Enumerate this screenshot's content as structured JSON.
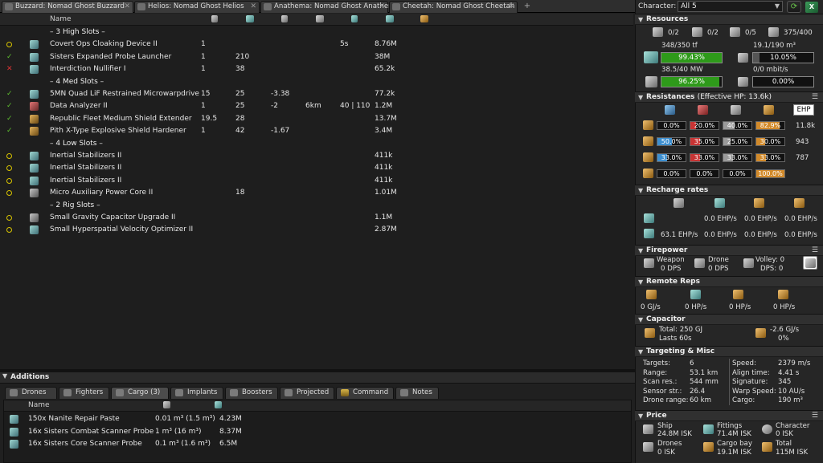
{
  "tabs": [
    {
      "label": "Buzzard: Nomad Ghost Buzzard"
    },
    {
      "label": "Helios: Nomad Ghost Helios"
    },
    {
      "label": "Anathema: Nomad Ghost Anathema"
    },
    {
      "label": "Cheetah: Nomad Ghost Cheetah"
    }
  ],
  "fitting": {
    "name_header": "Name",
    "rows": [
      {
        "kind": "rack",
        "name": "– 3 High Slots –"
      },
      {
        "kind": "mod",
        "state": "o",
        "icon": "cloak-icon",
        "name": "Covert Ops Cloaking Device II",
        "c1": "1",
        "c2": "",
        "c3": "",
        "c4": "",
        "c5": "5s",
        "c6": "8.76M"
      },
      {
        "kind": "mod",
        "state": "c",
        "icon": "probe-launcher-icon",
        "name": "Sisters Expanded Probe Launcher",
        "c1": "1",
        "c2": "210",
        "c3": "",
        "c4": "",
        "c5": "",
        "c6": "38M"
      },
      {
        "kind": "mod",
        "state": "x",
        "icon": "nullifier-icon",
        "name": "Interdiction Nullifier I",
        "c1": "1",
        "c2": "38",
        "c3": "",
        "c4": "",
        "c5": "",
        "c6": "65.2k"
      },
      {
        "kind": "rack",
        "name": "– 4 Med Slots –"
      },
      {
        "kind": "mod",
        "state": "c",
        "icon": "microwarpdrive-icon",
        "name": "5MN Quad LiF Restrained Microwarpdrive",
        "c1": "15",
        "c2": "25",
        "c3": "-3.38",
        "c4": "",
        "c5": "",
        "c6": "77.2k"
      },
      {
        "kind": "mod",
        "state": "c",
        "icon": "data-analyzer-icon",
        "name": "Data Analyzer II",
        "c1": "1",
        "c2": "25",
        "c3": "-2",
        "c4": "6km",
        "c5": "40 | 110",
        "c6": "1.2M"
      },
      {
        "kind": "mod",
        "state": "c",
        "icon": "shield-extender-icon",
        "name": "Republic Fleet Medium Shield Extender",
        "c1": "19.5",
        "c2": "28",
        "c3": "",
        "c4": "",
        "c5": "",
        "c6": "13.7M"
      },
      {
        "kind": "mod",
        "state": "c",
        "icon": "shield-hardener-icon",
        "name": "Pith X-Type Explosive Shield Hardener",
        "c1": "1",
        "c2": "42",
        "c3": "-1.67",
        "c4": "",
        "c5": "",
        "c6": "3.4M"
      },
      {
        "kind": "rack",
        "name": "– 4 Low Slots –"
      },
      {
        "kind": "mod",
        "state": "o",
        "icon": "inertial-stabilizer-icon",
        "name": "Inertial Stabilizers II",
        "c1": "",
        "c2": "",
        "c3": "",
        "c4": "",
        "c5": "",
        "c6": "411k"
      },
      {
        "kind": "mod",
        "state": "o",
        "icon": "inertial-stabilizer-icon",
        "name": "Inertial Stabilizers II",
        "c1": "",
        "c2": "",
        "c3": "",
        "c4": "",
        "c5": "",
        "c6": "411k"
      },
      {
        "kind": "mod",
        "state": "o",
        "icon": "inertial-stabilizer-icon",
        "name": "Inertial Stabilizers II",
        "c1": "",
        "c2": "",
        "c3": "",
        "c4": "",
        "c5": "",
        "c6": "411k"
      },
      {
        "kind": "mod",
        "state": "o",
        "icon": "power-core-icon",
        "name": "Micro Auxiliary Power Core II",
        "c1": "",
        "c2": "18",
        "c3": "",
        "c4": "",
        "c5": "",
        "c6": "1.01M"
      },
      {
        "kind": "rack",
        "name": "– 2 Rig Slots –"
      },
      {
        "kind": "mod",
        "state": "o",
        "icon": "capacitor-rig-icon",
        "name": "Small Gravity Capacitor Upgrade II",
        "c1": "",
        "c2": "",
        "c3": "",
        "c4": "",
        "c5": "",
        "c6": "1.1M"
      },
      {
        "kind": "mod",
        "state": "o",
        "icon": "velocity-rig-icon",
        "name": "Small Hyperspatial Velocity Optimizer II",
        "c1": "",
        "c2": "",
        "c3": "",
        "c4": "",
        "c5": "",
        "c6": "2.87M"
      }
    ]
  },
  "additions": {
    "title": "Additions",
    "tabs": [
      "Drones",
      "Fighters",
      "Cargo (3)",
      "Implants",
      "Boosters",
      "Projected",
      "Command",
      "Notes"
    ],
    "name_header": "Name",
    "items": [
      {
        "name": "150x Nanite Repair Paste",
        "volume": "0.01 m³ (1.5 m³)",
        "price": "4.23M"
      },
      {
        "name": "16x Sisters Combat Scanner Probe",
        "volume": "1 m³ (16 m³)",
        "price": "8.37M"
      },
      {
        "name": "16x Sisters Core Scanner Probe",
        "volume": "0.1 m³ (1.6 m³)",
        "price": "6.5M"
      }
    ]
  },
  "character": {
    "label": "Character:",
    "value": "All 5"
  },
  "resources": {
    "title": "Resources",
    "slots": [
      "0/2",
      "0/2",
      "0/5",
      "375/400"
    ],
    "cpu_text": "348/350 tf",
    "cpu_pct": "99.43%",
    "cpu_fraction": 0.9943,
    "cal_text": "19.1/190 m³",
    "cal_pct": "10.05%",
    "cal_fraction": 0.1005,
    "pg_text": "38.5/40 MW",
    "pg_pct": "96.25%",
    "pg_fraction": 0.9625,
    "bw_text": "0/0 mbit/s",
    "bw_pct": "0.00%",
    "bw_fraction": 0
  },
  "resistances": {
    "title": "Resistances",
    "ehp_label": "(Effective HP: 13.6k)",
    "ehp_button": "EHP",
    "rows": [
      {
        "vals": [
          "0.0%",
          "20.0%",
          "40.0%",
          "82.9%"
        ],
        "fr": [
          0,
          0.2,
          0.4,
          0.829
        ],
        "hp": "11.8k"
      },
      {
        "vals": [
          "50.0%",
          "35.0%",
          "25.0%",
          "30.0%"
        ],
        "fr": [
          0.5,
          0.35,
          0.25,
          0.3
        ],
        "hp": "943"
      },
      {
        "vals": [
          "33.0%",
          "33.0%",
          "33.0%",
          "33.0%"
        ],
        "fr": [
          0.33,
          0.33,
          0.33,
          0.33
        ],
        "hp": "787"
      },
      {
        "vals": [
          "0.0%",
          "0.0%",
          "0.0%",
          "100.0%"
        ],
        "fr": [
          0,
          0,
          0,
          1
        ],
        "hp": ""
      }
    ]
  },
  "recharge": {
    "title": "Recharge rates",
    "row1": [
      "0.0 EHP/s",
      "0.0 EHP/s",
      "0.0 EHP/s"
    ],
    "row2": [
      "63.1 EHP/s",
      "0.0 EHP/s",
      "0.0 EHP/s",
      "0.0 EHP/s"
    ]
  },
  "firepower": {
    "title": "Firepower",
    "weapon": "Weapon",
    "weapon_dps": "0 DPS",
    "drone": "Drone",
    "drone_dps": "0 DPS",
    "volley": "Volley: 0",
    "dps": "DPS: 0"
  },
  "remote": {
    "title": "Remote Reps",
    "vals": [
      "0 GJ/s",
      "0 HP/s",
      "0 HP/s",
      "0 HP/s"
    ]
  },
  "capacitor": {
    "title": "Capacitor",
    "total": "Total: 250 GJ",
    "lasts": "Lasts 60s",
    "rate": "-2.6 GJ/s",
    "pct": "0%"
  },
  "targeting": {
    "title": "Targeting & Misc",
    "left": [
      [
        "Targets:",
        "6"
      ],
      [
        "Range:",
        "53.1 km"
      ],
      [
        "Scan res.:",
        "544 mm"
      ],
      [
        "Sensor str.:",
        "26.4"
      ],
      [
        "Drone range:",
        "60 km"
      ]
    ],
    "right": [
      [
        "Speed:",
        "2379 m/s"
      ],
      [
        "Align time:",
        "4.41 s"
      ],
      [
        "Signature:",
        "345"
      ],
      [
        "Warp Speed:",
        "10 AU/s"
      ],
      [
        "Cargo:",
        "190 m³"
      ]
    ]
  },
  "price": {
    "title": "Price",
    "ship_l": "Ship",
    "ship_v": "24.8M ISK",
    "fit_l": "Fittings",
    "fit_v": "71.4M ISK",
    "char_l": "Character",
    "char_v": "0 ISK",
    "drone_l": "Drones",
    "drone_v": "0 ISK",
    "cargo_l": "Cargo bay",
    "cargo_v": "19.1M ISK",
    "total_l": "Total",
    "total_v": "115M ISK"
  },
  "colors": {
    "bar_green": "#2e9a1a",
    "em": "#3d8fd0",
    "thermal": "#c83434",
    "kinetic": "#9a9a9a",
    "explosive": "#d28a2a"
  }
}
